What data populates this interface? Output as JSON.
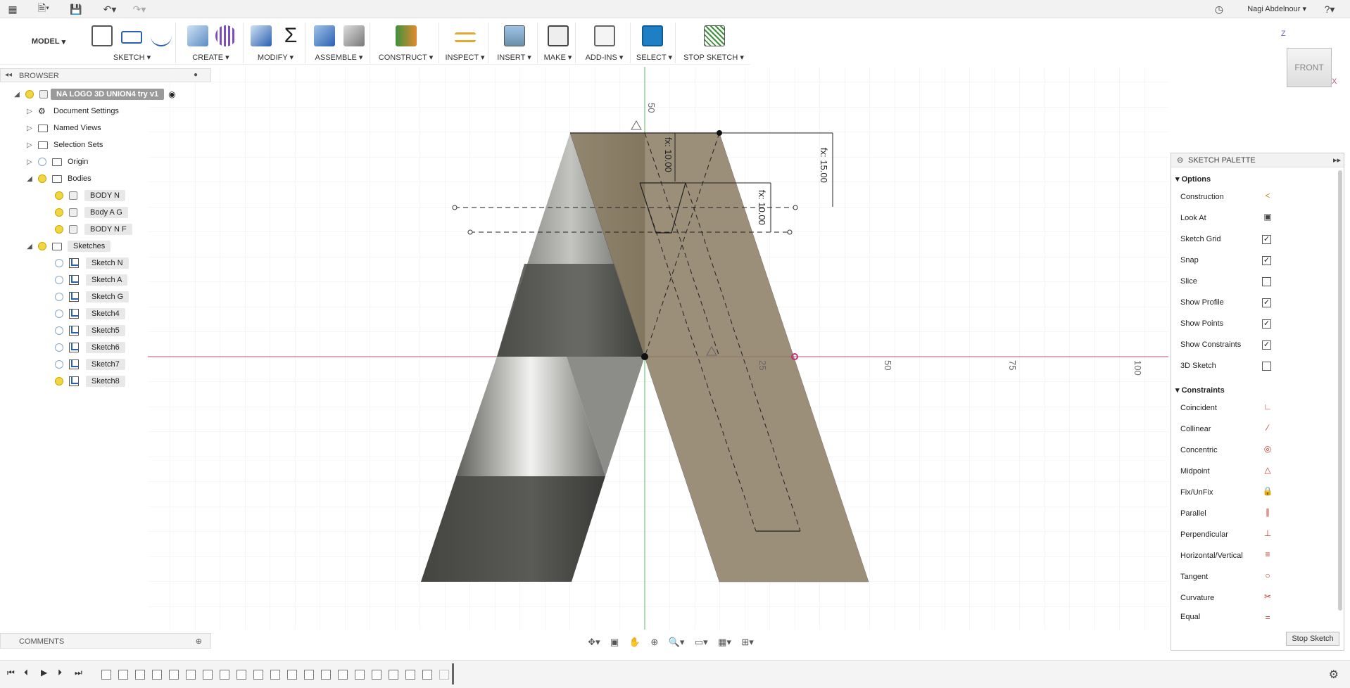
{
  "topbar": {
    "user_name": "Nagi Abdelnour",
    "icons": [
      "apps-grid-icon",
      "file-icon",
      "save-icon",
      "undo-icon",
      "redo-icon",
      "clock-icon",
      "help-icon"
    ]
  },
  "toolbar": {
    "workspace": "MODEL",
    "groups": [
      {
        "label": "SKETCH ▾"
      },
      {
        "label": "CREATE ▾"
      },
      {
        "label": "MODIFY ▾"
      },
      {
        "label": "ASSEMBLE ▾"
      },
      {
        "label": "CONSTRUCT ▾"
      },
      {
        "label": "INSPECT ▾"
      },
      {
        "label": "INSERT ▾"
      },
      {
        "label": "MAKE ▾"
      },
      {
        "label": "ADD-INS ▾"
      },
      {
        "label": "SELECT ▾"
      },
      {
        "label": "STOP SKETCH ▾"
      }
    ]
  },
  "browser": {
    "title": "BROWSER",
    "root": "NA LOGO 3D UNION4 try v1",
    "items": [
      {
        "label": "Document Settings"
      },
      {
        "label": "Named Views"
      },
      {
        "label": "Selection Sets"
      },
      {
        "label": "Origin"
      },
      {
        "label": "Bodies"
      },
      {
        "label": "BODY N"
      },
      {
        "label": "Body A G"
      },
      {
        "label": "BODY N F"
      },
      {
        "label": "Sketches"
      },
      {
        "label": "Sketch N"
      },
      {
        "label": "Sketch A"
      },
      {
        "label": "Sketch G"
      },
      {
        "label": "Sketch4"
      },
      {
        "label": "Sketch5"
      },
      {
        "label": "Sketch6"
      },
      {
        "label": "Sketch7"
      },
      {
        "label": "Sketch8"
      }
    ]
  },
  "comments": {
    "title": "COMMENTS"
  },
  "viewcube": {
    "face": "FRONT",
    "axis_z": "Z",
    "axis_x": "X"
  },
  "canvas": {
    "axis_ticks": [
      "50",
      "25",
      "50",
      "75",
      "100"
    ],
    "dimensions": [
      "fx: 10.00",
      "fx: 15.00",
      "fx: 10.00"
    ]
  },
  "palette": {
    "title": "SKETCH PALETTE",
    "options_title": "Options",
    "options": [
      {
        "label": "Construction",
        "icon": "construction-icon"
      },
      {
        "label": "Look At",
        "icon": "look-at-icon"
      },
      {
        "label": "Sketch Grid",
        "checked": "✓"
      },
      {
        "label": "Snap",
        "checked": "✓"
      },
      {
        "label": "Slice",
        "checked": ""
      },
      {
        "label": "Show Profile",
        "checked": "✓"
      },
      {
        "label": "Show Points",
        "checked": "✓"
      },
      {
        "label": "Show Constraints",
        "checked": "✓"
      },
      {
        "label": "3D Sketch",
        "checked": ""
      }
    ],
    "constraints_title": "Constraints",
    "constraints": [
      {
        "label": "Coincident",
        "glyph": "∟"
      },
      {
        "label": "Collinear",
        "glyph": "⁄"
      },
      {
        "label": "Concentric",
        "glyph": "◎"
      },
      {
        "label": "Midpoint",
        "glyph": "△"
      },
      {
        "label": "Fix/UnFix",
        "glyph": "🔒"
      },
      {
        "label": "Parallel",
        "glyph": "∥"
      },
      {
        "label": "Perpendicular",
        "glyph": "⊥"
      },
      {
        "label": "Horizontal/Vertical",
        "glyph": "≡"
      },
      {
        "label": "Tangent",
        "glyph": "○"
      },
      {
        "label": "Curvature",
        "glyph": "✂"
      },
      {
        "label": "Equal",
        "glyph": "="
      }
    ],
    "stop_button": "Stop Sketch"
  }
}
